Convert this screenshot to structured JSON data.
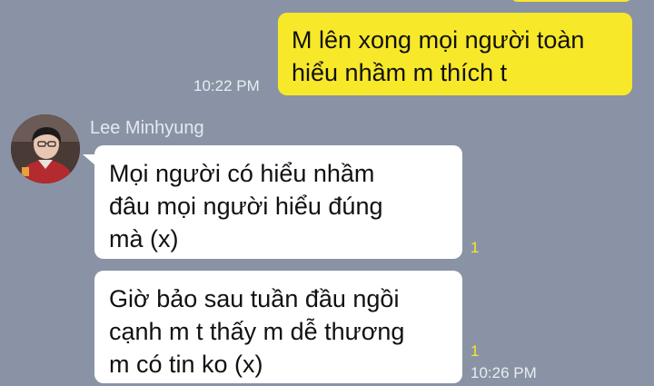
{
  "colors": {
    "chat_background": "#8a93a5",
    "outgoing_bubble": "#f7e82a",
    "incoming_bubble": "#ffffff",
    "unread_count": "#f7e82a"
  },
  "messages": [
    {
      "direction": "outgoing",
      "text": "M lên xong mọi người toàn\nhiểu nhầm m thích t",
      "time": "10:22 PM"
    },
    {
      "direction": "incoming",
      "sender": "Lee Minhyung",
      "avatar": "profile-photo",
      "text": "Mọi người có hiểu nhầm\nđâu mọi người hiểu đúng\nmà (x)",
      "unread": "1"
    },
    {
      "direction": "incoming",
      "text": "Giờ bảo sau tuần đầu ngồi\ncạnh m t thấy m dễ thương\nm có tin ko (x)",
      "unread": "1",
      "time": "10:26 PM"
    }
  ]
}
